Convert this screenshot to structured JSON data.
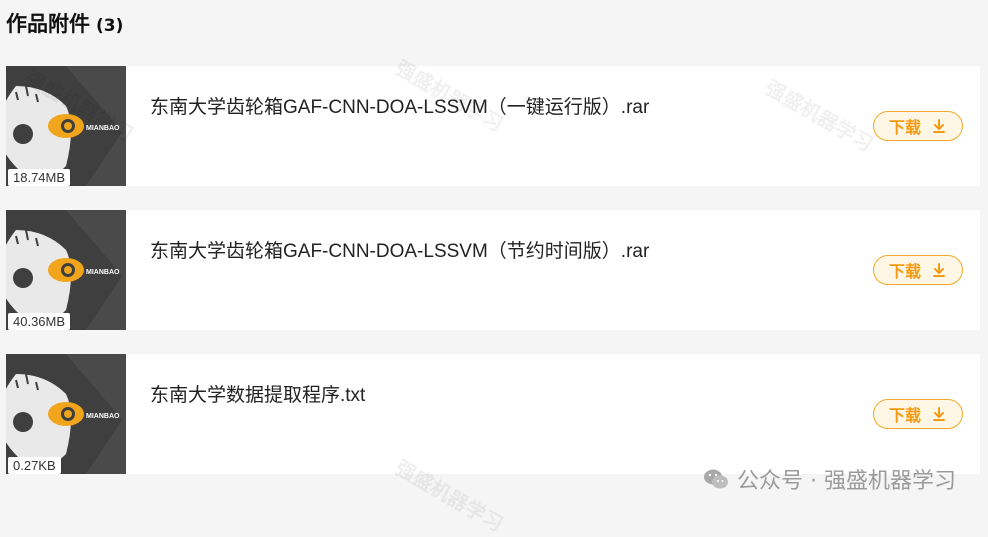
{
  "header": {
    "title": "作品附件",
    "count": "(3)"
  },
  "files": [
    {
      "name": "东南大学齿轮箱GAF-CNN-DOA-LSSVM（一键运行版）.rar",
      "size": "18.74MB",
      "download_label": "下载"
    },
    {
      "name": "东南大学齿轮箱GAF-CNN-DOA-LSSVM（节约时间版）.rar",
      "size": "40.36MB",
      "download_label": "下载"
    },
    {
      "name": "东南大学数据提取程序.txt",
      "size": "0.27KB",
      "download_label": "下载"
    }
  ],
  "thumbnail_brand": "MIANBAO",
  "watermark_text": "强盛机器学习",
  "footer": {
    "brand": "公众号 · 强盛机器学习",
    "icon": "wechat-icon"
  },
  "colors": {
    "accent": "#f39a12",
    "accent_border": "#f3a72b",
    "thumb_bg": "#3f3f3f"
  }
}
